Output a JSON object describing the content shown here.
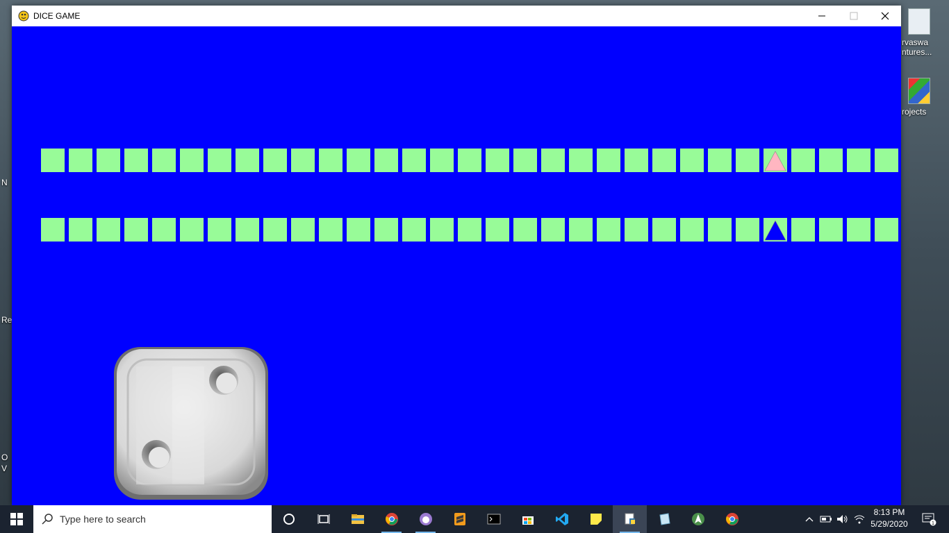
{
  "window": {
    "title": "DICE GAME"
  },
  "board": {
    "rows": 2,
    "columns": 31,
    "player1": {
      "color": "#ffb6c1",
      "position": 26
    },
    "player2": {
      "color": "#0000ff",
      "position": 26
    },
    "cell_color": "#98fb98",
    "background": "#0000ff"
  },
  "dice": {
    "value": 2
  },
  "desktop": {
    "icons": [
      {
        "label": "arvaswa\nntures..."
      },
      {
        "label": "rojects"
      }
    ],
    "left_fragments": [
      "N",
      "Re",
      "O",
      "V"
    ]
  },
  "taskbar": {
    "search_placeholder": "Type here to search",
    "apps": [
      "cortana-icon",
      "task-view-icon",
      "file-explorer-icon",
      "chrome-icon",
      "github-desktop-icon",
      "sublime-text-icon",
      "terminal-icon",
      "microsoft-store-icon",
      "vscode-icon",
      "sticky-notes-icon",
      "python-idle-icon",
      "notepad-icon",
      "android-studio-icon",
      "chrome-icon"
    ],
    "time": "8:13 PM",
    "date": "5/29/2020",
    "notification_count": "1"
  }
}
